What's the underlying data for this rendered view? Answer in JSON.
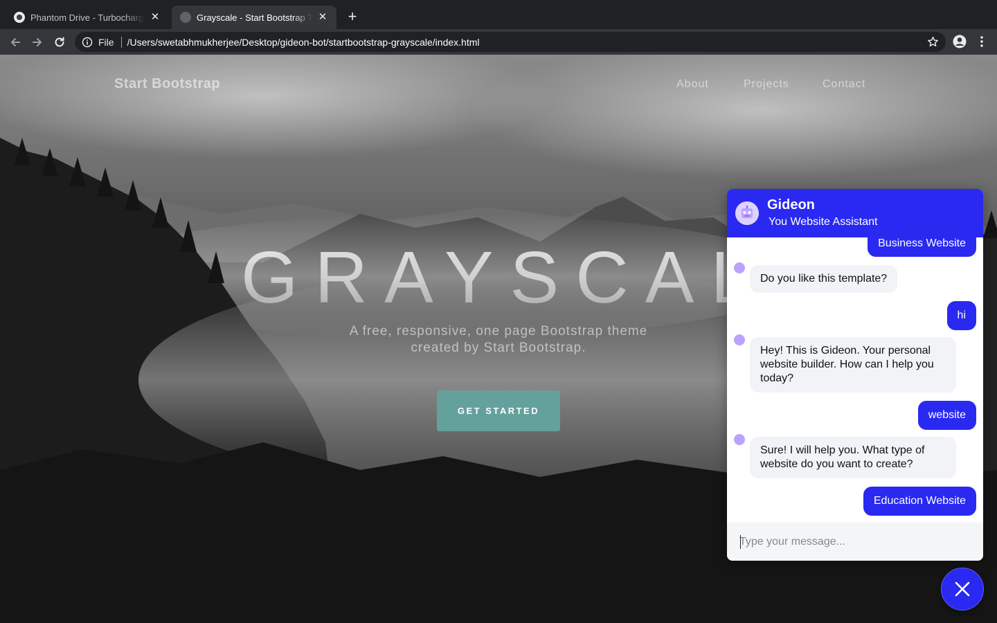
{
  "browser": {
    "tabs": [
      {
        "title": "Phantom Drive - Turbocharge your",
        "active": false,
        "close_glyph": "✕"
      },
      {
        "title": "Grayscale - Start Bootstrap Theme",
        "active": true,
        "close_glyph": "✕"
      }
    ],
    "new_tab_glyph": "+",
    "address": {
      "scheme": "File",
      "url": "/Users/swetabhmukherjee/Desktop/gideon-bot/startbootstrap-grayscale/index.html"
    },
    "icons": [
      "back-arrow-icon",
      "forward-arrow-icon",
      "reload-icon",
      "info-icon",
      "star-icon",
      "profile-icon",
      "kebab-menu-icon"
    ]
  },
  "page": {
    "brand": "Start Bootstrap",
    "nav": [
      {
        "label": "About"
      },
      {
        "label": "Projects"
      },
      {
        "label": "Contact"
      }
    ],
    "hero": {
      "title": "GRAYSCALE",
      "subtitle": "A free, responsive, one page Bootstrap theme created by Start Bootstrap.",
      "cta": "GET STARTED"
    },
    "colors": {
      "cta": "#64a19d",
      "chat_accent": "#2929f2"
    }
  },
  "chat": {
    "name": "Gideon",
    "status": "You Website Assistant",
    "messages": [
      {
        "from": "user",
        "text": "Business Website"
      },
      {
        "from": "bot",
        "text": "Do you like this template?"
      },
      {
        "from": "user",
        "text": "hi"
      },
      {
        "from": "bot",
        "text": "Hey! This is Gideon. Your personal website builder. How can I help you today?"
      },
      {
        "from": "user",
        "text": "website"
      },
      {
        "from": "bot",
        "text": "Sure! I will help you. What type of website do you want to create?"
      },
      {
        "from": "user",
        "text": "Education Website"
      }
    ],
    "input_placeholder": "Type your message...",
    "close_icon": "close-icon"
  }
}
